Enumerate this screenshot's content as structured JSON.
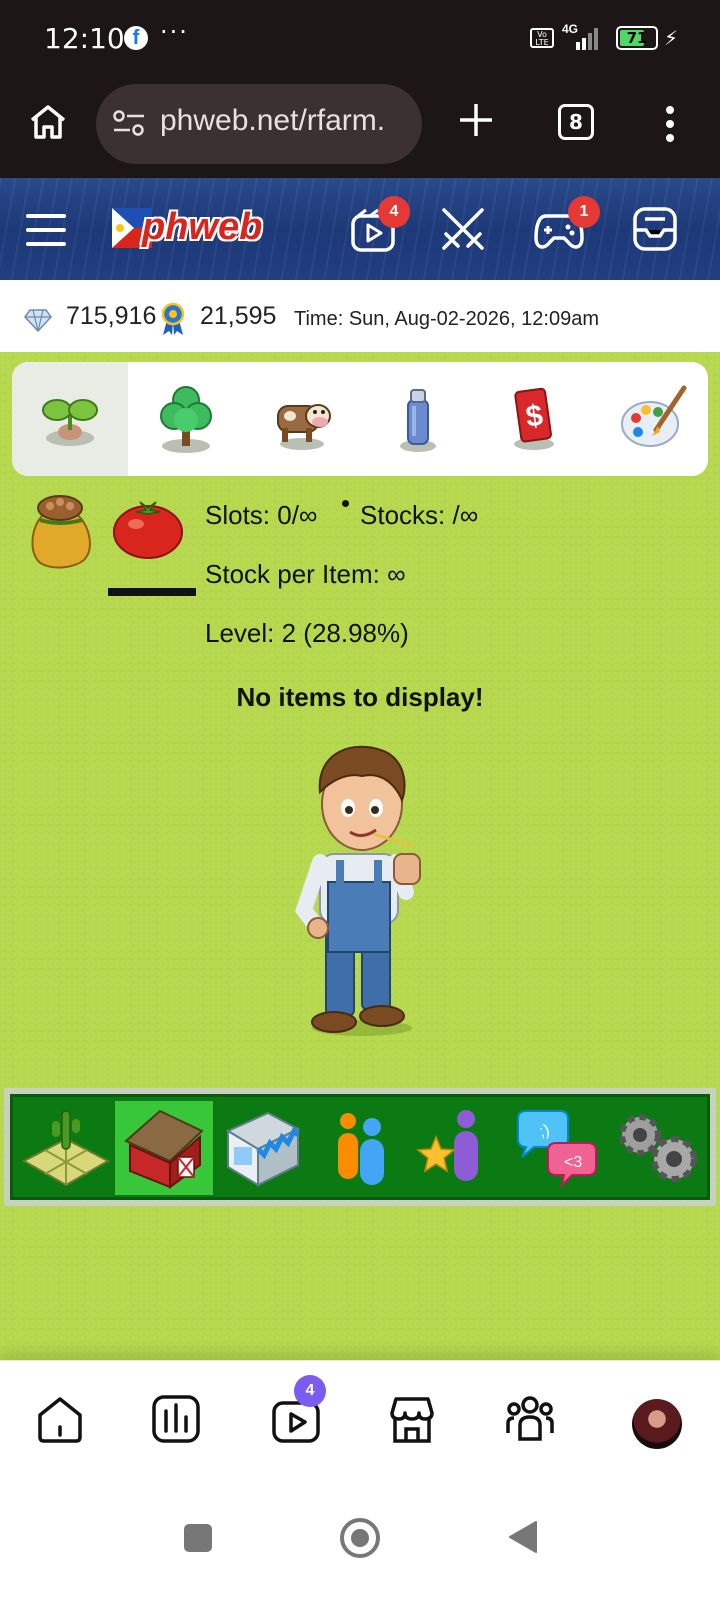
{
  "status_bar": {
    "time": "12:10",
    "dots": "···",
    "network": "4G",
    "battery": "71",
    "battery_level": 0.71,
    "volte_label": "Vo LTE"
  },
  "browser": {
    "url": "phweb.net/rfarm.",
    "tab_count": "8"
  },
  "site_header": {
    "logo_text": "phweb",
    "video_badge": "4",
    "games_badge": "1"
  },
  "stats": {
    "gems": "715,916",
    "medals": "21,595",
    "time": "Time: Sun, Aug-02-2026, 12:09am"
  },
  "category_tabs": [
    {
      "name": "seeds",
      "icon": "sprout-icon",
      "active": true
    },
    {
      "name": "trees",
      "icon": "tree-icon",
      "active": false
    },
    {
      "name": "animals",
      "icon": "cow-icon",
      "active": false
    },
    {
      "name": "tools",
      "icon": "spray-can-icon",
      "active": false
    },
    {
      "name": "cash",
      "icon": "cash-card-icon",
      "active": false
    },
    {
      "name": "decorations",
      "icon": "palette-icon",
      "active": false
    }
  ],
  "storage": {
    "slots_label": "Slots: 0/∞",
    "stocks_label": "Stocks: /∞",
    "stock_per_item": "Stock per Item: ∞",
    "level": "Level: 2 (28.98%)",
    "empty_message": "No items to display!"
  },
  "game_nav": [
    {
      "name": "farm",
      "icon": "farm-plot-icon",
      "active": false
    },
    {
      "name": "barn",
      "icon": "barn-icon",
      "active": true
    },
    {
      "name": "shop",
      "icon": "shop-icon",
      "active": false
    },
    {
      "name": "neighbors",
      "icon": "people-icon",
      "active": false
    },
    {
      "name": "favorites",
      "icon": "star-person-icon",
      "active": false
    },
    {
      "name": "messages",
      "icon": "chat-bubbles-icon",
      "active": false
    },
    {
      "name": "settings",
      "icon": "gears-icon",
      "active": false
    }
  ],
  "site_tabs": {
    "video_badge": "4"
  },
  "colors": {
    "grass": "#b5d84e",
    "nav_green": "#0c7a12",
    "nav_active": "#39c73a",
    "badge_red": "#e53935",
    "badge_purple": "#7b5cf0"
  }
}
